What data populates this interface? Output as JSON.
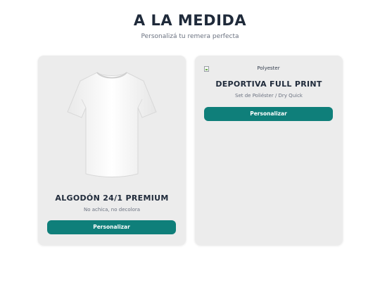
{
  "header": {
    "title": "A LA MEDIDA",
    "subtitle": "Personalizá tu remera perfecta"
  },
  "cards": [
    {
      "image_alt": "",
      "image_icon": "tshirt-icon",
      "title": "ALGODÓN 24/1 PREMIUM",
      "subtitle": "No achica, no decolora",
      "button_label": "Personalizar"
    },
    {
      "image_alt": "Polyester",
      "image_icon": "broken-image-icon",
      "title": "DEPORTIVA FULL PRINT",
      "subtitle": "Set de Poliéster / Dry Quick",
      "button_label": "Personalizar"
    }
  ],
  "colors": {
    "accent": "#0f7f7a",
    "card_bg": "#ececec",
    "title": "#1f2a3a"
  }
}
